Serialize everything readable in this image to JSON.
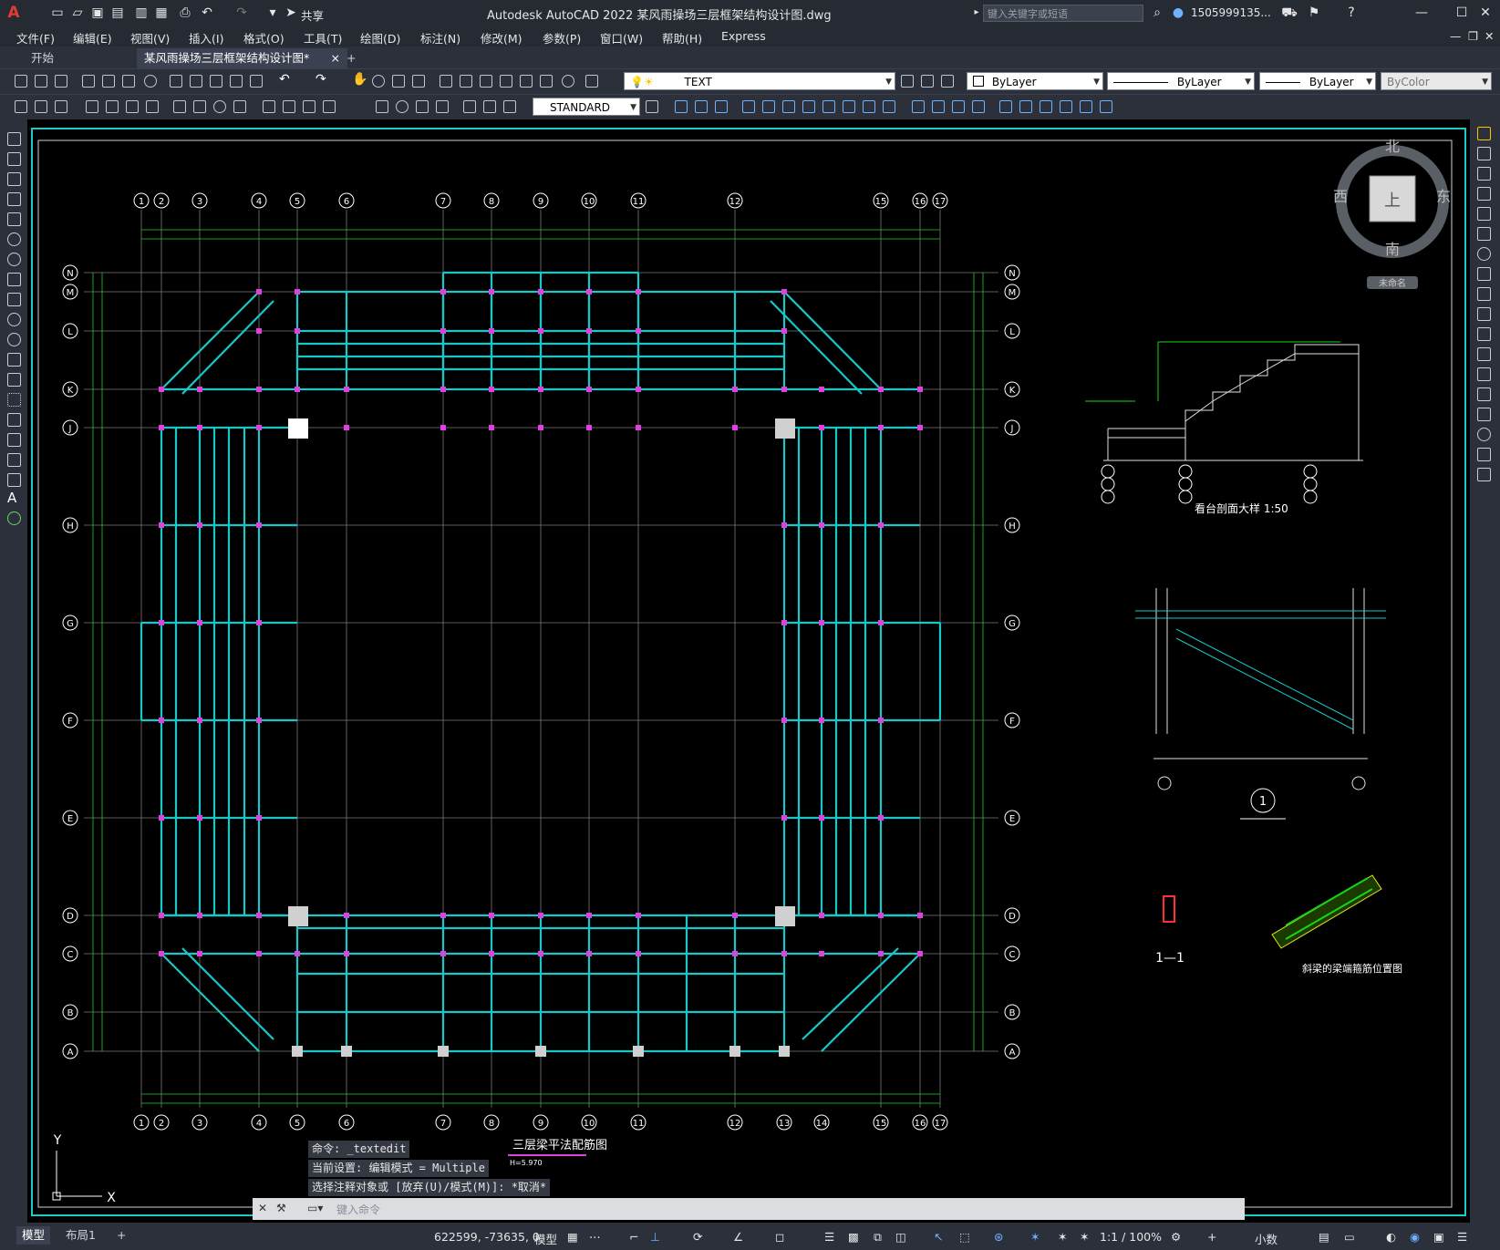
{
  "titlebar": {
    "app_title": "Autodesk AutoCAD 2022    某风雨操场三层框架结构设计图.dwg",
    "share_label": "共享",
    "search_placeholder": "键入关键字或短语",
    "user_name": "1505999135...",
    "app_logo": "A"
  },
  "menu": {
    "items": [
      "文件(F)",
      "编辑(E)",
      "视图(V)",
      "插入(I)",
      "格式(O)",
      "工具(T)",
      "绘图(D)",
      "标注(N)",
      "修改(M)",
      "参数(P)",
      "窗口(W)",
      "帮助(H)",
      "Express"
    ]
  },
  "tabs": {
    "start": "开始",
    "active": "某风雨操场三层框架结构设计图*",
    "close": "×",
    "add": "+"
  },
  "toolbar": {
    "layer_combo": "TEXT",
    "color_combo": "ByLayer",
    "linetype_combo": "ByLayer",
    "lineweight_combo": "ByLayer",
    "plotstyle_combo": "ByColor",
    "textstyle_combo": "STANDARD"
  },
  "viewcube": {
    "north": "北",
    "south": "南",
    "east": "东",
    "west": "西",
    "top": "上",
    "wcs": "未命名"
  },
  "drawing": {
    "grid_top": [
      "1",
      "2",
      "3",
      "4",
      "5",
      "6",
      "7",
      "8",
      "9",
      "10",
      "11",
      "12",
      "15",
      "16",
      "17"
    ],
    "grid_bottom": [
      "1",
      "2",
      "3",
      "4",
      "5",
      "6",
      "7",
      "8",
      "9",
      "10",
      "11",
      "12",
      "13",
      "14",
      "15",
      "16",
      "17"
    ],
    "grid_rows": [
      "N",
      "M",
      "L",
      "K",
      "J",
      "H",
      "G",
      "F",
      "E",
      "D",
      "C",
      "B",
      "A"
    ],
    "plan_title": "三层梁平法配筋图",
    "plan_subtitle": "H=5.970",
    "section_title": "看台剖面大样 1:50",
    "detail_1_label": "1",
    "detail_11_label": "1—1",
    "detail_stair_title": "斜梁的梁端箍筋位置图",
    "ucs_x": "X",
    "ucs_y": "Y"
  },
  "command": {
    "history": [
      "命令: _textedit",
      "当前设置: 编辑模式 = Multiple",
      "选择注释对象或 [放弃(U)/模式(M)]: *取消*"
    ],
    "input_placeholder": "键入命令"
  },
  "status": {
    "model_tab": "模型",
    "layout_tab": "布局1",
    "coordinates": "622599, -73635, 0",
    "space": "模型",
    "scale": "1:1 / 100%",
    "units": "小数"
  }
}
